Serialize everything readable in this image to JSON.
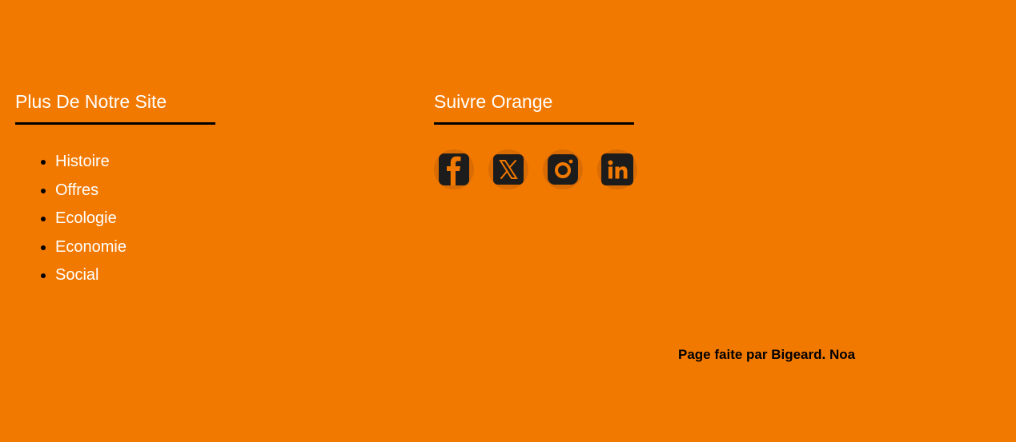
{
  "footer": {
    "site_links": {
      "title": "Plus De Notre Site",
      "items": [
        {
          "label": "Histoire"
        },
        {
          "label": "Offres"
        },
        {
          "label": "Ecologie"
        },
        {
          "label": "Economie"
        },
        {
          "label": "Social"
        }
      ]
    },
    "follow": {
      "title": "Suivre Orange",
      "socials": [
        {
          "name": "facebook-icon"
        },
        {
          "name": "x-twitter-icon"
        },
        {
          "name": "instagram-icon"
        },
        {
          "name": "linkedin-icon"
        }
      ]
    },
    "credit": "Page faite par Bigeard. Noa"
  },
  "colors": {
    "background": "#f27900",
    "icon_circle": "#d96c04",
    "icon_tile": "#1c1c1c",
    "text_light": "#ffffff",
    "rule": "#000000"
  }
}
